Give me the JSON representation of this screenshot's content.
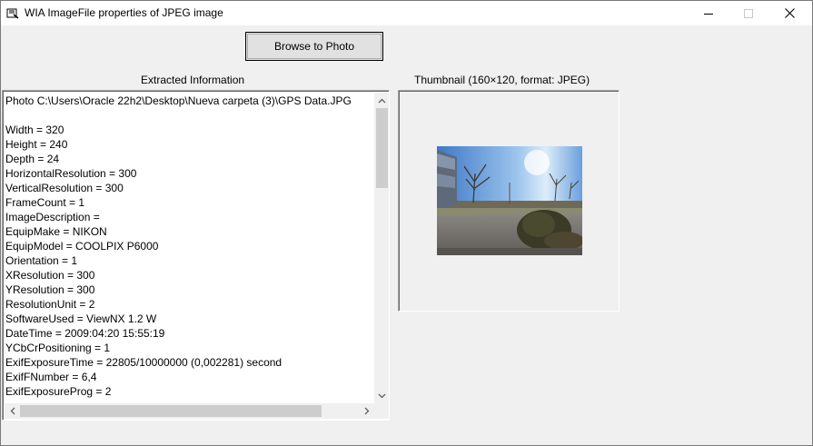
{
  "window": {
    "title": "WIA ImageFile properties of JPEG image"
  },
  "colors": {
    "titlebar_bg": "#ffffff",
    "window_bg": "#f0f0f0",
    "button_bg": "#e1e1e1",
    "scrollbar_thumb": "#cdcdcd"
  },
  "icons": {
    "app": "app-icon",
    "minimize": "minimize-icon",
    "maximize": "maximize-icon",
    "close": "close-icon",
    "scroll_up": "chevron-up-icon",
    "scroll_down": "chevron-down-icon",
    "scroll_left": "chevron-left-icon",
    "scroll_right": "chevron-right-icon"
  },
  "toolbar": {
    "browse_label": "Browse to Photo"
  },
  "extracted": {
    "label": "Extracted Information",
    "lines": [
      "Photo C:\\Users\\Oracle 22h2\\Desktop\\Nueva carpeta (3)\\GPS Data.JPG",
      "",
      "Width = 320",
      "Height = 240",
      "Depth = 24",
      "HorizontalResolution = 300",
      "VerticalResolution = 300",
      "FrameCount = 1",
      "ImageDescription =",
      "EquipMake = NIKON",
      "EquipModel = COOLPIX P6000",
      "Orientation = 1",
      "XResolution = 300",
      "YResolution = 300",
      "ResolutionUnit = 2",
      "SoftwareUsed = ViewNX 1.2 W",
      "DateTime = 2009:04:20 15:55:19",
      "YCbCrPositioning = 1",
      "ExifExposureTime = 22805/10000000 (0,002281) second",
      "ExifFNumber = 6,4",
      "ExifExposureProg = 2"
    ]
  },
  "thumbnail": {
    "label": "Thumbnail (160×120, format: JPEG)"
  }
}
